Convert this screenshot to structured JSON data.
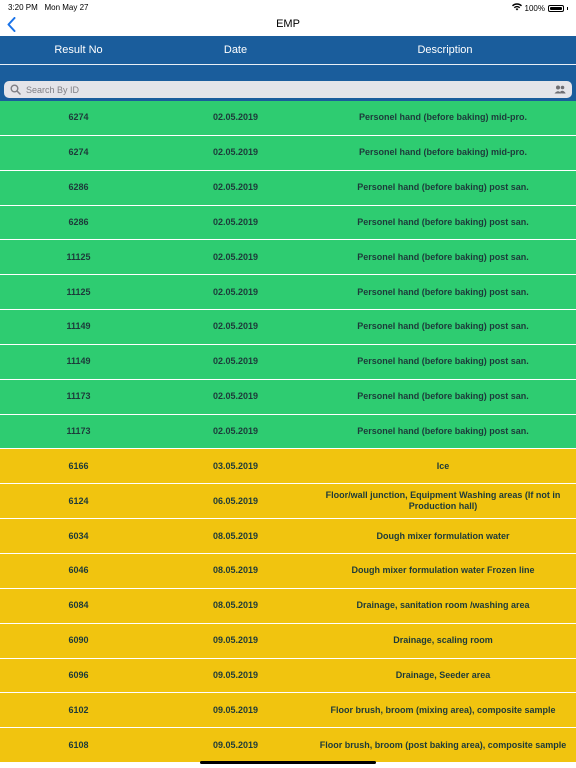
{
  "status_bar": {
    "time": "3:20 PM",
    "date": "Mon May 27",
    "battery": "100%",
    "battery_level": 1.0
  },
  "nav": {
    "title": "EMP"
  },
  "table_header": {
    "result_no": "Result No",
    "date": "Date",
    "description": "Description"
  },
  "search": {
    "placeholder": "Search By ID",
    "value": ""
  },
  "colors": {
    "header_blue": "#1a5d9c",
    "green": "#2ecc71",
    "yellow": "#f1c40f"
  },
  "rows": [
    {
      "result_no": "6274",
      "date": "02.05.2019",
      "description": "Personel hand (before baking) mid-pro.",
      "status": "green"
    },
    {
      "result_no": "6274",
      "date": "02.05.2019",
      "description": "Personel hand (before baking) mid-pro.",
      "status": "green"
    },
    {
      "result_no": "6286",
      "date": "02.05.2019",
      "description": "Personel hand (before baking) post san.",
      "status": "green"
    },
    {
      "result_no": "6286",
      "date": "02.05.2019",
      "description": "Personel hand (before baking) post san.",
      "status": "green"
    },
    {
      "result_no": "11125",
      "date": "02.05.2019",
      "description": "Personel hand (before baking) post san.",
      "status": "green"
    },
    {
      "result_no": "11125",
      "date": "02.05.2019",
      "description": "Personel hand (before baking) post san.",
      "status": "green"
    },
    {
      "result_no": "11149",
      "date": "02.05.2019",
      "description": "Personel hand (before baking) post san.",
      "status": "green"
    },
    {
      "result_no": "11149",
      "date": "02.05.2019",
      "description": "Personel hand (before baking) post san.",
      "status": "green"
    },
    {
      "result_no": "11173",
      "date": "02.05.2019",
      "description": "Personel hand (before baking) post san.",
      "status": "green"
    },
    {
      "result_no": "11173",
      "date": "02.05.2019",
      "description": "Personel hand (before baking) post san.",
      "status": "green"
    },
    {
      "result_no": "6166",
      "date": "03.05.2019",
      "description": "Ice",
      "status": "yellow"
    },
    {
      "result_no": "6124",
      "date": "06.05.2019",
      "description": "Floor/wall junction, Equipment Washing areas (If not in Production hall)",
      "status": "yellow"
    },
    {
      "result_no": "6034",
      "date": "08.05.2019",
      "description": "Dough mixer formulation water",
      "status": "yellow"
    },
    {
      "result_no": "6046",
      "date": "08.05.2019",
      "description": "Dough mixer formulation water Frozen line",
      "status": "yellow"
    },
    {
      "result_no": "6084",
      "date": "08.05.2019",
      "description": "Drainage, sanitation room /washing area",
      "status": "yellow"
    },
    {
      "result_no": "6090",
      "date": "09.05.2019",
      "description": "Drainage, scaling room",
      "status": "yellow"
    },
    {
      "result_no": "6096",
      "date": "09.05.2019",
      "description": "Drainage, Seeder area",
      "status": "yellow"
    },
    {
      "result_no": "6102",
      "date": "09.05.2019",
      "description": "Floor brush, broom (mixing area), composite sample",
      "status": "yellow"
    },
    {
      "result_no": "6108",
      "date": "09.05.2019",
      "description": "Floor brush, broom (post baking area), composite sample",
      "status": "yellow"
    }
  ]
}
